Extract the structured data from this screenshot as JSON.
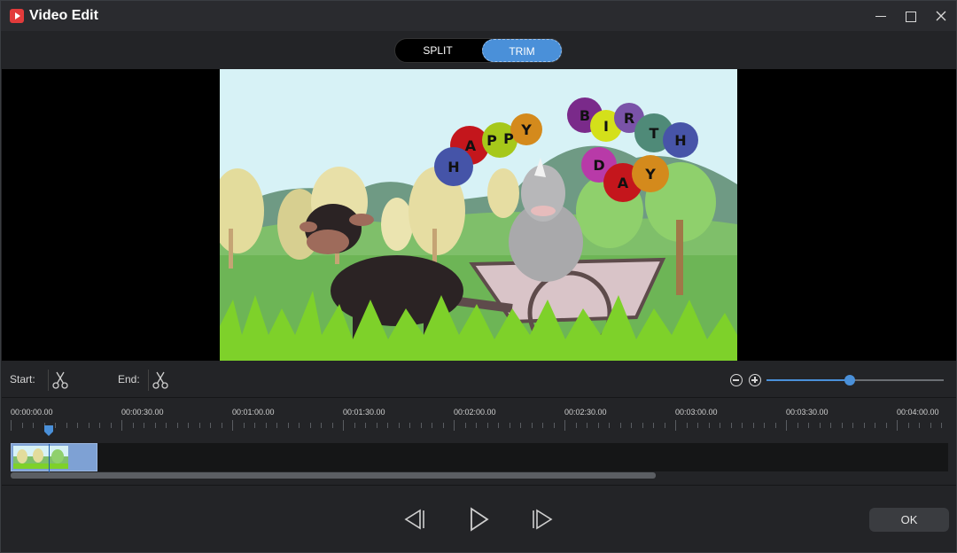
{
  "window": {
    "title": "Video Edit"
  },
  "mode": {
    "split_label": "SPLIT",
    "trim_label": "TRIM",
    "active": "TRIM"
  },
  "trim": {
    "start_label": "Start:",
    "end_label": "End:"
  },
  "zoom": {
    "level": 0.47
  },
  "timeline": {
    "ticks": [
      "00:00:00.00",
      "00:00:30.00",
      "00:01:00.00",
      "00:01:30.00",
      "00:02:00.00",
      "00:02:30.00",
      "00:03:00.00",
      "00:03:30.00",
      "00:04:00.00"
    ]
  },
  "preview": {
    "balloons_left": [
      "H",
      "A",
      "P",
      "P",
      "Y"
    ],
    "balloons_right": [
      "B",
      "I",
      "R",
      "T",
      "H",
      "D",
      "A",
      "Y"
    ]
  },
  "footer": {
    "ok_label": "OK"
  },
  "colors": {
    "accent": "#4a90d9",
    "background": "#232427"
  },
  "icons": [
    "app-icon",
    "minimize-icon",
    "maximize-icon",
    "close-icon",
    "scissors-icon",
    "zoom-out-icon",
    "zoom-in-icon",
    "previous-frame-icon",
    "play-icon",
    "next-frame-icon"
  ]
}
